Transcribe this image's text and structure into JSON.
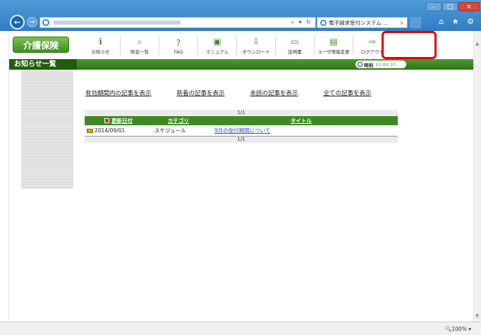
{
  "browser": {
    "tab_title": "電子請求受付システム ...",
    "tab_close": "×",
    "address_tools": "⌕ ▾ ↻",
    "window_controls": [
      "–",
      "□",
      "×"
    ],
    "chrome_icons": "⌂ ★ ⚙",
    "zoom_level": "100%",
    "zoom_prefix": "🔍"
  },
  "header": {
    "logo_label": "介護保険",
    "toolbar": [
      {
        "icon": "info-icon",
        "glyph": "ℹ",
        "label": "お知らせ"
      },
      {
        "icon": "search-icon",
        "glyph": "⌕",
        "label": "照会一覧"
      },
      {
        "icon": "faq-icon",
        "glyph": "?",
        "label": "FAQ"
      },
      {
        "icon": "manual-icon",
        "glyph": "▣",
        "label": "マニュアル"
      },
      {
        "icon": "download-icon",
        "glyph": "⇩",
        "label": "ダウンロード"
      },
      {
        "icon": "certificate-icon",
        "glyph": "▭",
        "label": "証明書"
      },
      {
        "icon": "user-info-icon",
        "glyph": "▤",
        "label": "ユーザ情報変更"
      },
      {
        "icon": "logout-icon",
        "glyph": "⇨",
        "label": "ログアウト"
      }
    ]
  },
  "titlebar": {
    "title": "お知らせ一覧",
    "clock_label": "時刻",
    "clock_value": "10:00:10"
  },
  "filters": [
    "有効期間内の記事を表示",
    "新着の記事を表示",
    "未読の記事を表示",
    "全ての記事を表示"
  ],
  "table": {
    "pager_top": "1/1",
    "pager_bottom": "1/1",
    "columns": [
      "更新日付",
      "カテゴリ",
      "タイトル"
    ],
    "rows": [
      {
        "date": "2014/09/01",
        "category": "スケジュール",
        "title": "9月の受付期間について"
      }
    ]
  }
}
